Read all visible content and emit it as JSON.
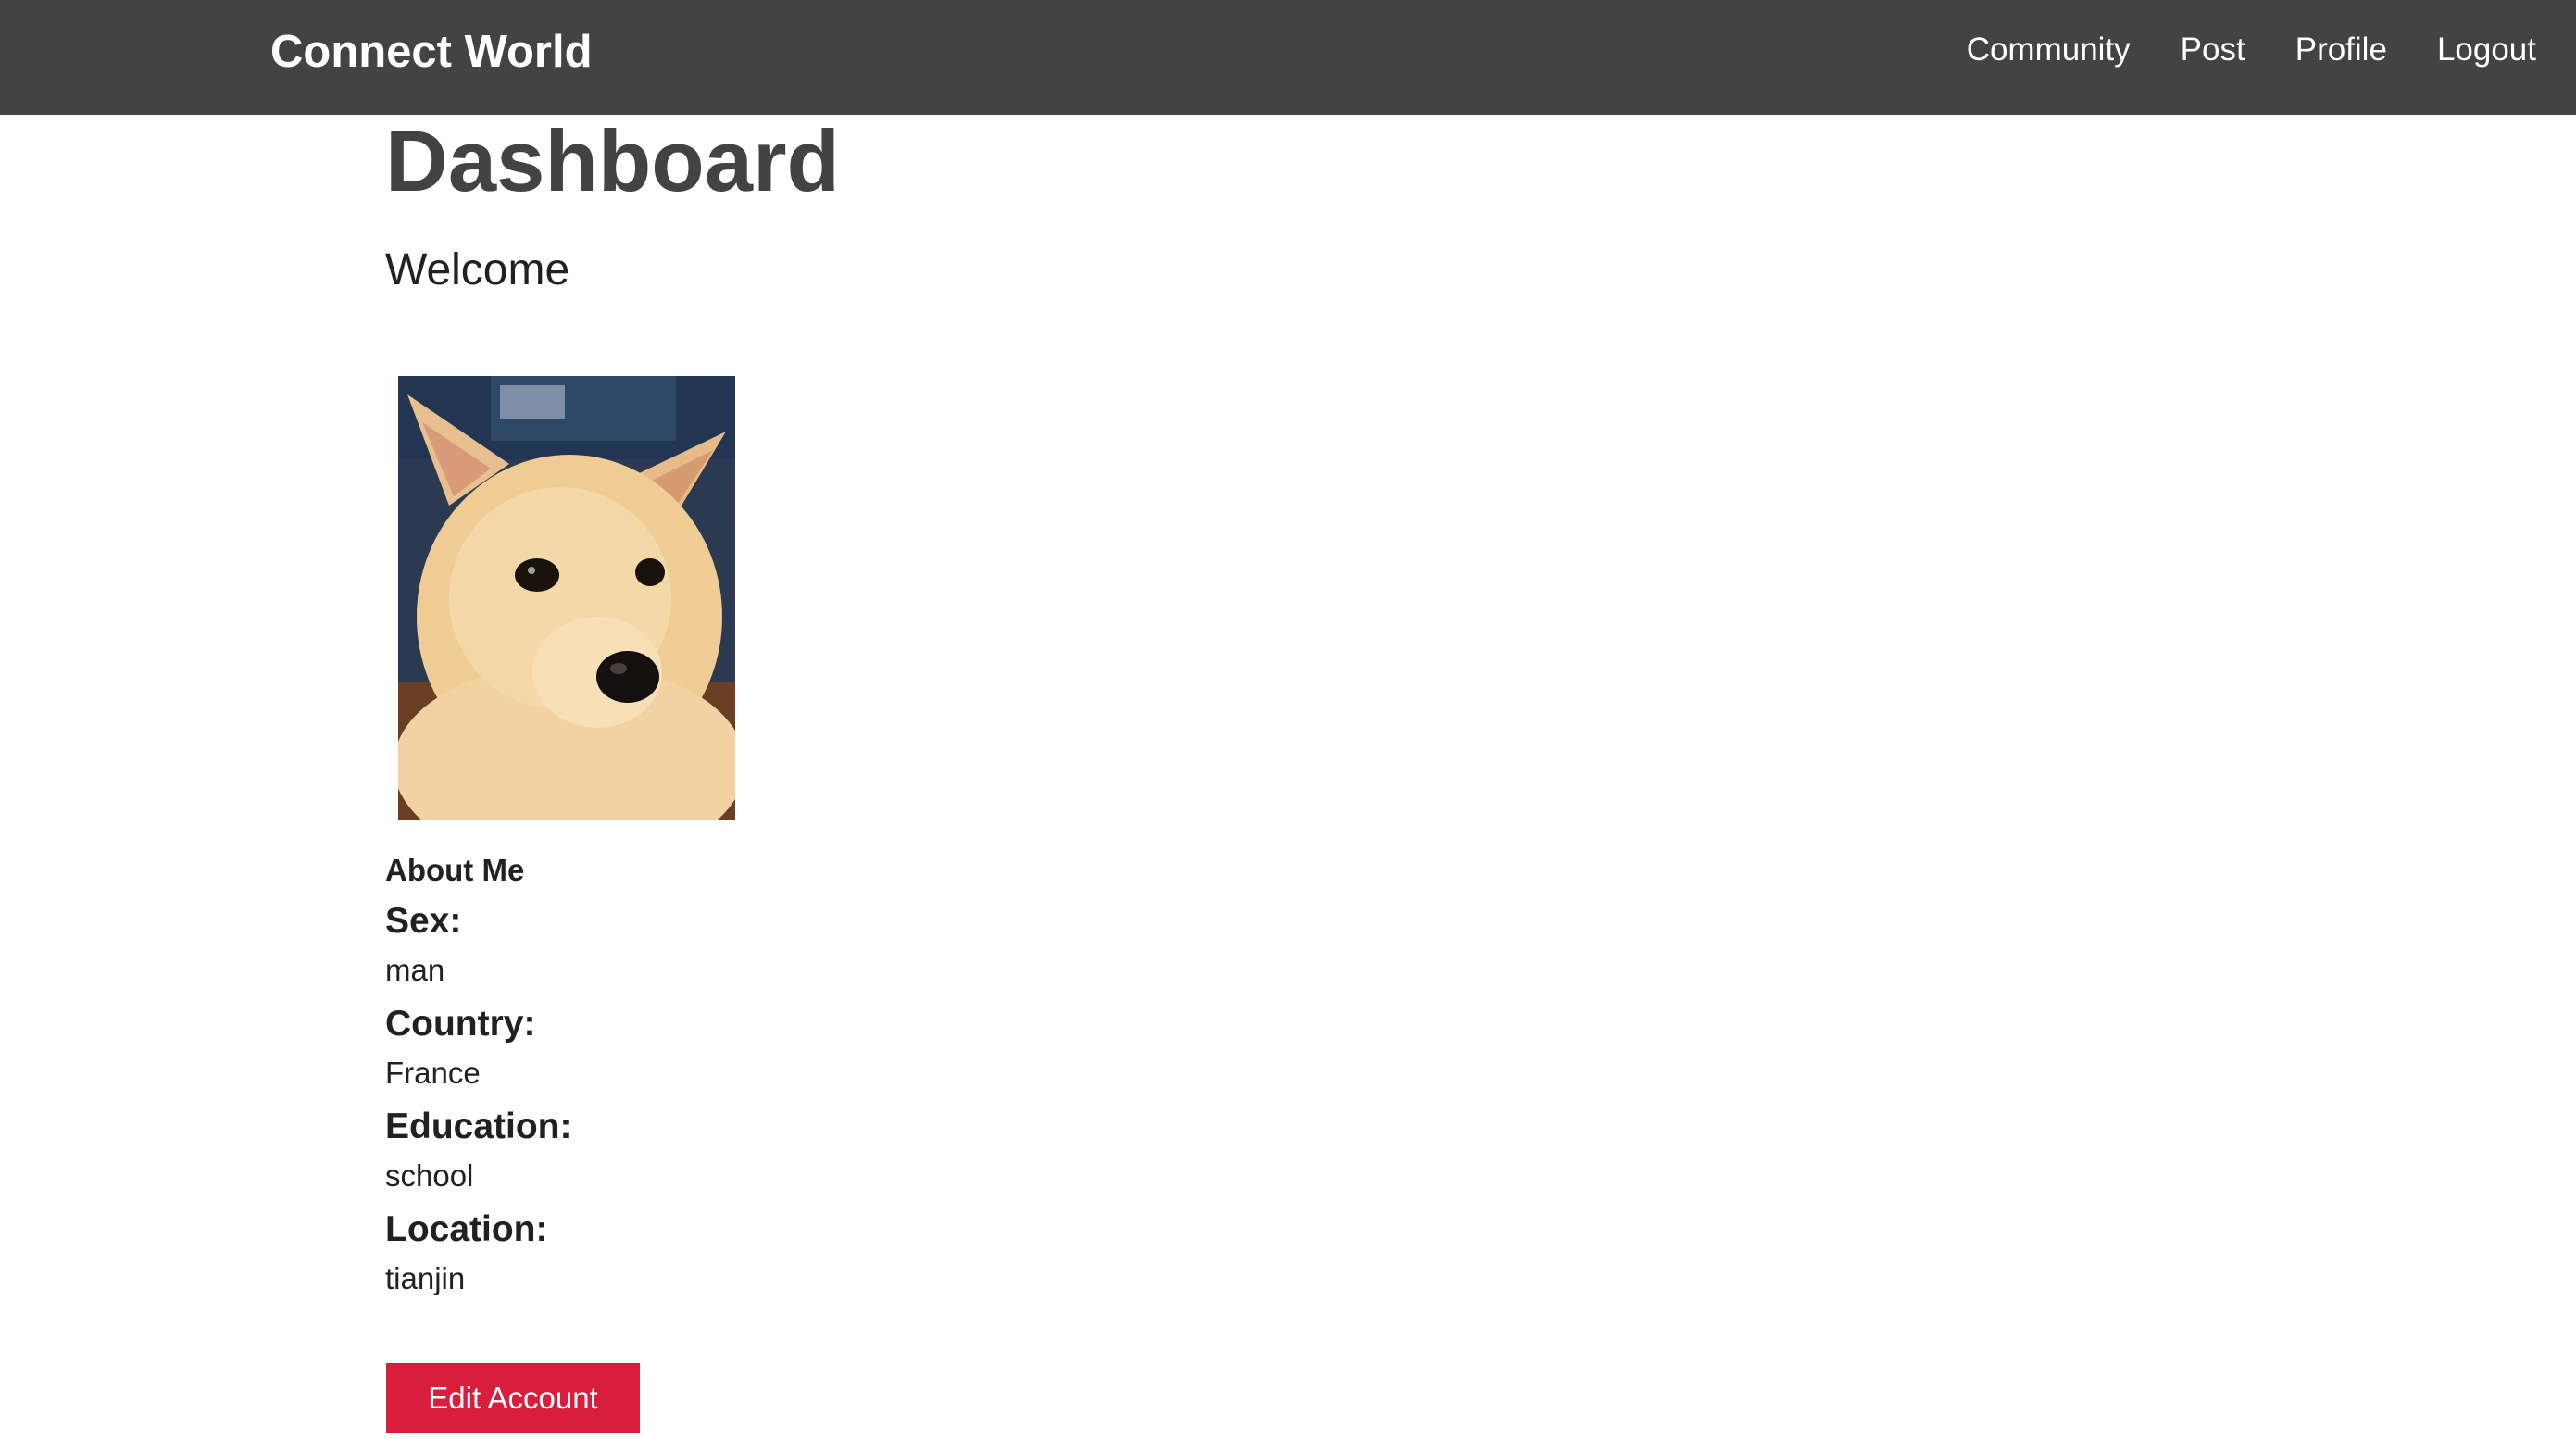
{
  "navbar": {
    "brand": "Connect World",
    "links": [
      "Community",
      "Post",
      "Profile",
      "Logout"
    ]
  },
  "page": {
    "title": "Dashboard",
    "welcome": "Welcome"
  },
  "about": {
    "title": "About Me",
    "fields": [
      {
        "label": "Sex:",
        "value": "man"
      },
      {
        "label": "Country:",
        "value": "France"
      },
      {
        "label": "Education:",
        "value": "school"
      },
      {
        "label": "Location:",
        "value": "tianjin"
      }
    ]
  },
  "actions": {
    "edit_label": "Edit Account"
  },
  "colors": {
    "navbar_bg": "#434343",
    "accent_button": "#d81e3c"
  }
}
